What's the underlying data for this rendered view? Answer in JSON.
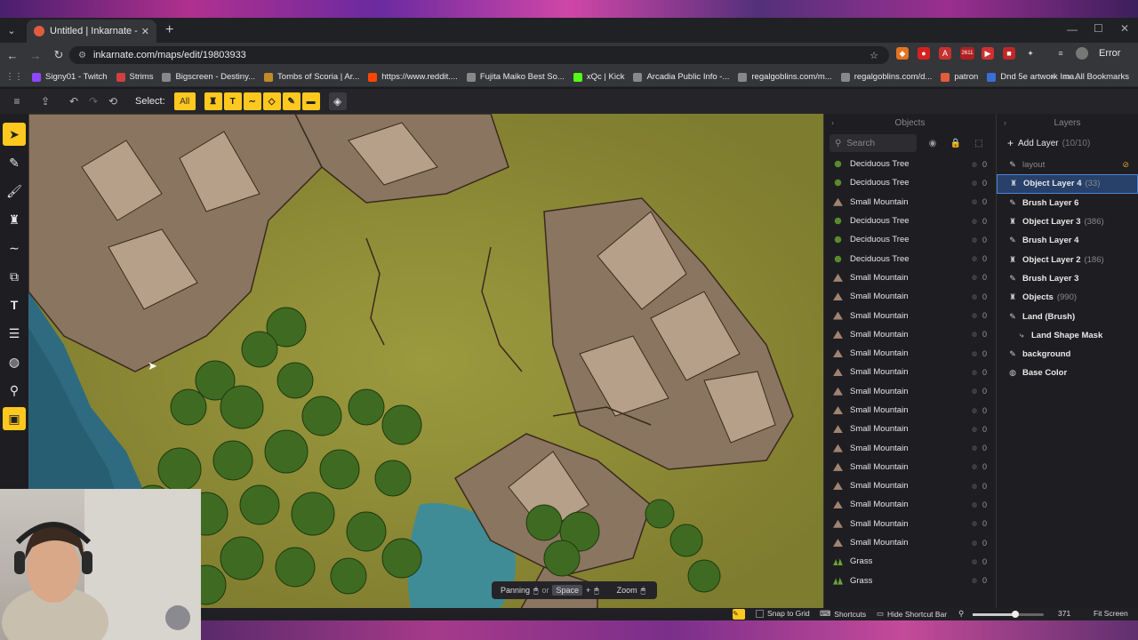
{
  "browser": {
    "tab_title": "Untitled | Inkarnate - Create Fa",
    "url": "inkarnate.com/maps/edit/19803933",
    "error_label": "Error",
    "ext_badge": "2611",
    "bookmarks": [
      {
        "label": "Signy01 - Twitch",
        "color": "#9146ff"
      },
      {
        "label": "Strims",
        "color": "#d04040"
      },
      {
        "label": "Bigscreen - Destiny...",
        "color": "#888888"
      },
      {
        "label": "Tombs of Scoria | Ar...",
        "color": "#c08a2a"
      },
      {
        "label": "https://www.reddit....",
        "color": "#ff4500"
      },
      {
        "label": "Fujita Maiko Best So...",
        "color": "#888888"
      },
      {
        "label": "xQc | Kick",
        "color": "#53fc18"
      },
      {
        "label": "Arcadia Public Info -...",
        "color": "#888888"
      },
      {
        "label": "regalgoblins.com/m...",
        "color": "#888888"
      },
      {
        "label": "regalgoblins.com/d...",
        "color": "#888888"
      },
      {
        "label": "patron",
        "color": "#e25c3c"
      },
      {
        "label": "Dnd 5e artwork Ima...",
        "color": "#3a6fd8"
      }
    ],
    "all_bookmarks": "All Bookmarks"
  },
  "toolbar": {
    "select_label": "Select:",
    "filter_all": "All"
  },
  "objects_panel": {
    "title": "Objects",
    "search_placeholder": "Search",
    "items": [
      {
        "name": "Deciduous Tree",
        "icon": "tree",
        "count": "0"
      },
      {
        "name": "Deciduous Tree",
        "icon": "tree",
        "count": "0"
      },
      {
        "name": "Small Mountain",
        "icon": "mountain",
        "count": "0"
      },
      {
        "name": "Deciduous Tree",
        "icon": "tree",
        "count": "0"
      },
      {
        "name": "Deciduous Tree",
        "icon": "tree",
        "count": "0"
      },
      {
        "name": "Deciduous Tree",
        "icon": "tree",
        "count": "0"
      },
      {
        "name": "Small Mountain",
        "icon": "mountain",
        "count": "0"
      },
      {
        "name": "Small Mountain",
        "icon": "mountain",
        "count": "0"
      },
      {
        "name": "Small Mountain",
        "icon": "mountain",
        "count": "0"
      },
      {
        "name": "Small Mountain",
        "icon": "mountain",
        "count": "0"
      },
      {
        "name": "Small Mountain",
        "icon": "mountain",
        "count": "0"
      },
      {
        "name": "Small Mountain",
        "icon": "mountain",
        "count": "0"
      },
      {
        "name": "Small Mountain",
        "icon": "mountain",
        "count": "0"
      },
      {
        "name": "Small Mountain",
        "icon": "mountain",
        "count": "0"
      },
      {
        "name": "Small Mountain",
        "icon": "mountain",
        "count": "0"
      },
      {
        "name": "Small Mountain",
        "icon": "mountain",
        "count": "0"
      },
      {
        "name": "Small Mountain",
        "icon": "mountain",
        "count": "0"
      },
      {
        "name": "Small Mountain",
        "icon": "mountain",
        "count": "0"
      },
      {
        "name": "Small Mountain",
        "icon": "mountain",
        "count": "0"
      },
      {
        "name": "Small Mountain",
        "icon": "mountain",
        "count": "0"
      },
      {
        "name": "Small Mountain",
        "icon": "mountain",
        "count": "0"
      },
      {
        "name": "Grass",
        "icon": "grass",
        "count": "0"
      },
      {
        "name": "Grass",
        "icon": "grass",
        "count": "0"
      }
    ]
  },
  "layers_panel": {
    "title": "Layers",
    "add_layer": "Add Layer",
    "add_layer_count": "(10/10)",
    "items": [
      {
        "name": "layout",
        "count": "",
        "icon": "brush",
        "dim": true,
        "indent": false,
        "selected": false,
        "hidden": true
      },
      {
        "name": "Object Layer 4",
        "count": "(33)",
        "icon": "object",
        "dim": false,
        "indent": false,
        "selected": true,
        "hidden": false
      },
      {
        "name": "Brush Layer 6",
        "count": "",
        "icon": "brush",
        "dim": false,
        "indent": false,
        "selected": false,
        "hidden": false
      },
      {
        "name": "Object Layer 3",
        "count": "(386)",
        "icon": "object",
        "dim": false,
        "indent": false,
        "selected": false,
        "hidden": false
      },
      {
        "name": "Brush Layer 4",
        "count": "",
        "icon": "brush",
        "dim": false,
        "indent": false,
        "selected": false,
        "hidden": false
      },
      {
        "name": "Object Layer 2",
        "count": "(186)",
        "icon": "object",
        "dim": false,
        "indent": false,
        "selected": false,
        "hidden": false
      },
      {
        "name": "Brush Layer 3",
        "count": "",
        "icon": "brush",
        "dim": false,
        "indent": false,
        "selected": false,
        "hidden": false
      },
      {
        "name": "Objects",
        "count": "(990)",
        "icon": "object",
        "dim": false,
        "indent": false,
        "selected": false,
        "hidden": false
      },
      {
        "name": "Land (Brush)",
        "count": "",
        "icon": "brush",
        "dim": false,
        "indent": false,
        "selected": false,
        "hidden": false
      },
      {
        "name": "Land Shape Mask",
        "count": "",
        "icon": "mask",
        "dim": false,
        "indent": true,
        "selected": false,
        "hidden": false
      },
      {
        "name": "background",
        "count": "",
        "icon": "brush",
        "dim": false,
        "indent": false,
        "selected": false,
        "hidden": false
      },
      {
        "name": "Base Color",
        "count": "",
        "icon": "color",
        "dim": false,
        "indent": false,
        "selected": false,
        "hidden": false
      }
    ]
  },
  "pan_hint": {
    "panning": "Panning",
    "or": "or",
    "space": "Space",
    "plus": "+",
    "zoom": "Zoom"
  },
  "bottom_bar": {
    "snap": "Snap to Grid",
    "shortcuts": "Shortcuts",
    "hide_shortcut": "Hide Shortcut Bar",
    "zoom_value": "371",
    "fit": "Fit Screen"
  },
  "colors": {
    "accent": "#ffc81e",
    "selection": "#27416a"
  }
}
